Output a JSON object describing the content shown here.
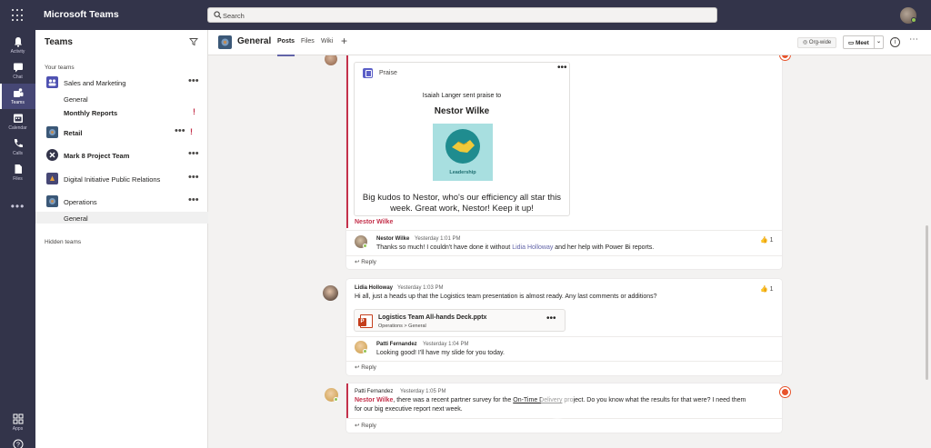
{
  "app": {
    "title": "Microsoft Teams"
  },
  "search": {
    "placeholder": "Search"
  },
  "colors": {
    "titlebar": "#33344a",
    "accent": "#6264a7",
    "important": "#c4314b",
    "presence": "#92c353"
  },
  "rail": {
    "items": [
      {
        "label": "Activity",
        "icon": "bell-icon"
      },
      {
        "label": "Chat",
        "icon": "chat-icon"
      },
      {
        "label": "Teams",
        "icon": "teams-icon",
        "active": true
      },
      {
        "label": "Calendar",
        "icon": "calendar-icon"
      },
      {
        "label": "Calls",
        "icon": "phone-icon"
      },
      {
        "label": "Files",
        "icon": "file-icon"
      }
    ],
    "more": "•••",
    "bottom": [
      {
        "label": "Apps",
        "icon": "apps-icon"
      },
      {
        "label": "",
        "icon": "help-icon"
      }
    ]
  },
  "teams_panel": {
    "title": "Teams",
    "your_teams_label": "Your teams",
    "hidden_teams_label": "Hidden teams",
    "teams": [
      {
        "name": "Sales and Marketing",
        "channels": [
          {
            "name": "General"
          },
          {
            "name": "Monthly Reports",
            "bold": true,
            "important": true
          }
        ]
      },
      {
        "name": "Retail",
        "bold": true,
        "important": true
      },
      {
        "name": "Mark 8 Project Team",
        "bold": true
      },
      {
        "name": "Digital Initiative Public Relations"
      },
      {
        "name": "Operations",
        "channels": [
          {
            "name": "General",
            "selected": true
          }
        ]
      }
    ]
  },
  "channel": {
    "name": "General",
    "tabs": [
      "Posts",
      "Files",
      "Wiki"
    ],
    "add_tab": "+",
    "org_wide": "Org-wide",
    "meet": "Meet"
  },
  "feed": {
    "praise_post": {
      "card_label": "Praise",
      "sent_text": "Isaiah Langer sent praise to",
      "recipient": "Nestor Wilke",
      "badge": "Leadership",
      "kudos": "Big kudos to Nestor, who's our efficiency all star this week. Great work, Nestor! Keep it up!",
      "mention": "Nestor Wilke",
      "reply": {
        "sender": "Nestor Wilke",
        "time": "Yesterday 1:01 PM",
        "text_before": "Thanks so much! I couldn't have done it without ",
        "link": "Lidia Holloway",
        "text_after": " and her help with Power Bi reports.",
        "likes": "1"
      },
      "reply_label": "Reply"
    },
    "logistics_post": {
      "sender": "Lidia Holloway",
      "time": "Yesterday 1:03 PM",
      "text": "Hi all, just a heads up that the Logistics team presentation is almost ready. Any last comments or additions?",
      "likes": "1",
      "file": {
        "name": "Logistics Team All-hands Deck.pptx",
        "path": "Operations > General"
      },
      "reply": {
        "sender": "Patti Fernandez",
        "time": "Yesterday 1:04 PM",
        "text": "Looking good! I'll have my slide for you today."
      },
      "reply_label": "Reply"
    },
    "survey_post": {
      "sender": "Patti Fernandez",
      "time": "Yesterday 1:05 PM",
      "mention": "Nestor Wilke",
      "text_a": ", there was a recent partner survey for the ",
      "link": "On-Time Delivery",
      "text_b": " project. Do you know what the results for that were? I need them",
      "text_c": "for our big executive report next week.",
      "reply_label": "Reply"
    }
  }
}
